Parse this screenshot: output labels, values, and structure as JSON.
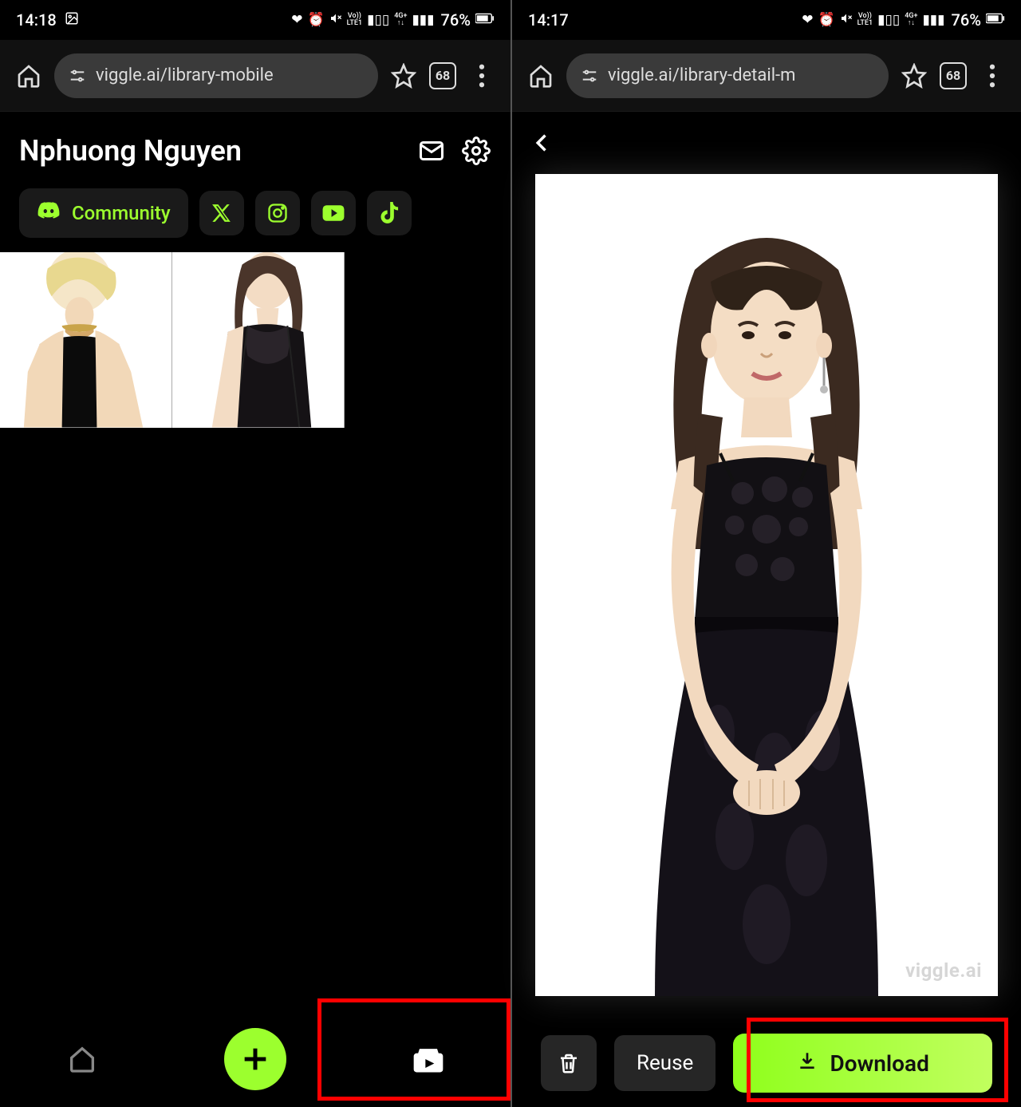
{
  "left": {
    "status": {
      "time": "14:18",
      "battery_pct": "76%"
    },
    "browser": {
      "url": "viggle.ai/library-mobile",
      "tab_count": "68"
    },
    "header": {
      "title": "Nphuong Nguyen"
    },
    "social": {
      "community_label": "Community",
      "icons": [
        "discord",
        "x",
        "instagram",
        "youtube",
        "tiktok"
      ]
    },
    "nav": {
      "items": [
        "home",
        "add",
        "library"
      ]
    }
  },
  "right": {
    "status": {
      "time": "14:17",
      "battery_pct": "76%"
    },
    "browser": {
      "url": "viggle.ai/library-detail-m",
      "tab_count": "68"
    },
    "watermark": "viggle.ai",
    "actions": {
      "reuse_label": "Reuse",
      "download_label": "Download"
    }
  }
}
